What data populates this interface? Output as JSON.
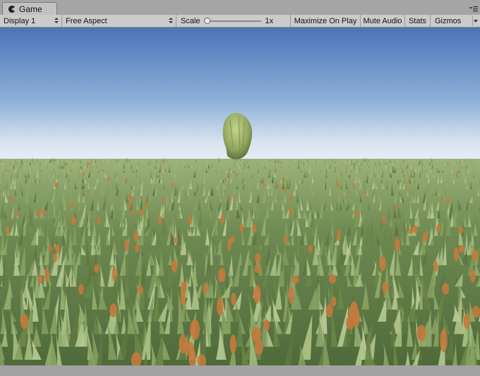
{
  "tab": {
    "title": "Game",
    "icon": "pacman-game-icon"
  },
  "tab_menu_icon": "panel-menu-icon",
  "toolbar": {
    "display_label": "Display 1",
    "aspect_label": "Free Aspect",
    "scale_label": "Scale",
    "scale_value": "1x",
    "scale_slider_level": 0.0,
    "maximize_label": "Maximize On Play",
    "mute_label": "Mute Audio",
    "stats_label": "Stats",
    "gizmos_label": "Gizmos"
  },
  "viewport": {
    "scene": "grass-field-with-tree",
    "sky_top_color": "#4a74b7",
    "sky_horizon_color": "#e7eef6",
    "grass_color": "#8aa468",
    "flower_color": "#c47a3c"
  }
}
